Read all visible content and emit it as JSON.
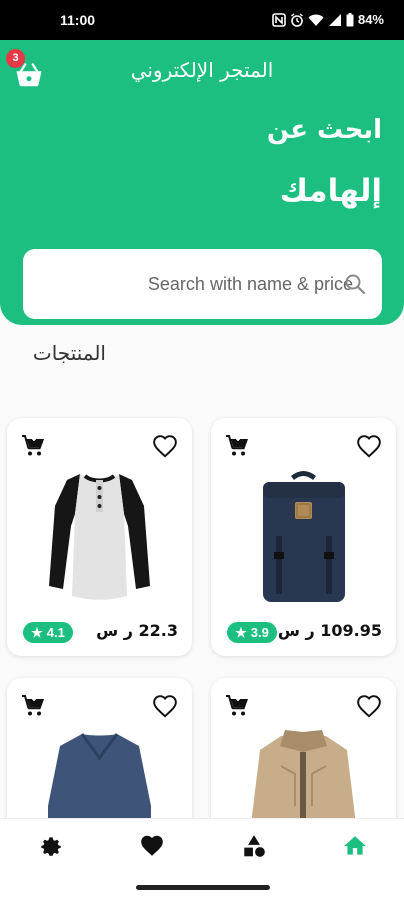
{
  "status_bar": {
    "time": "11:00",
    "battery": "84%",
    "icons": [
      "nfc-icon",
      "alarm-icon",
      "wifi-icon",
      "signal-icon",
      "battery-icon"
    ]
  },
  "header": {
    "title": "المتجر الإلكتروني",
    "cart_badge": "3",
    "headline_line1": "ابحث عن",
    "headline_line2": "إلهامك",
    "background_color": "#1cbf7f"
  },
  "search": {
    "placeholder": "Search with name & price",
    "value": ""
  },
  "products_section": {
    "title": "المنتجات"
  },
  "products": [
    {
      "name": "raglan-henley-shirt",
      "price": "22.3 ر س",
      "rating": "4.1"
    },
    {
      "name": "navy-backpack",
      "price": "109.95 ر س",
      "rating": "3.9"
    },
    {
      "name": "navy-vneck-sweater",
      "price": "",
      "rating": ""
    },
    {
      "name": "beige-jacket",
      "price": "",
      "rating": ""
    }
  ],
  "bottom_nav": {
    "items": [
      "settings-icon",
      "heart-icon",
      "categories-icon",
      "home-icon"
    ],
    "active": "home-icon",
    "active_color": "#1cbf7f"
  }
}
